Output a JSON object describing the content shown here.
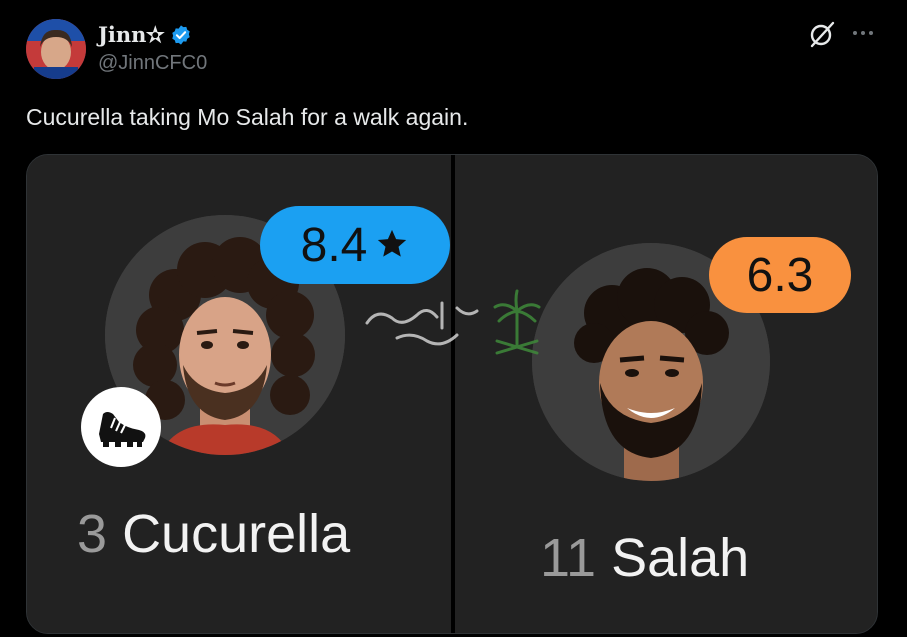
{
  "author": {
    "display_name": "Jinn✫",
    "handle": "@JinnCFC0",
    "verified": true
  },
  "post": {
    "text": "Cucurella taking Mo Salah for a walk again."
  },
  "icons": {
    "grok": "grok-icon",
    "more": "more-icon",
    "verified": "verified-badge-icon",
    "boot": "football-boot-icon",
    "star": "star-icon"
  },
  "players": [
    {
      "number": "3",
      "name": "Cucurella",
      "rating": "8.4",
      "motm": true,
      "badge_color": "#1ba0f2"
    },
    {
      "number": "11",
      "name": "Salah",
      "rating": "6.3",
      "motm": false,
      "badge_color": "#f9913f"
    }
  ],
  "colors": {
    "background": "#000000",
    "card": "#222222",
    "text": "#e7e9ea",
    "muted": "#71767b",
    "verified": "#1d9bf0"
  }
}
